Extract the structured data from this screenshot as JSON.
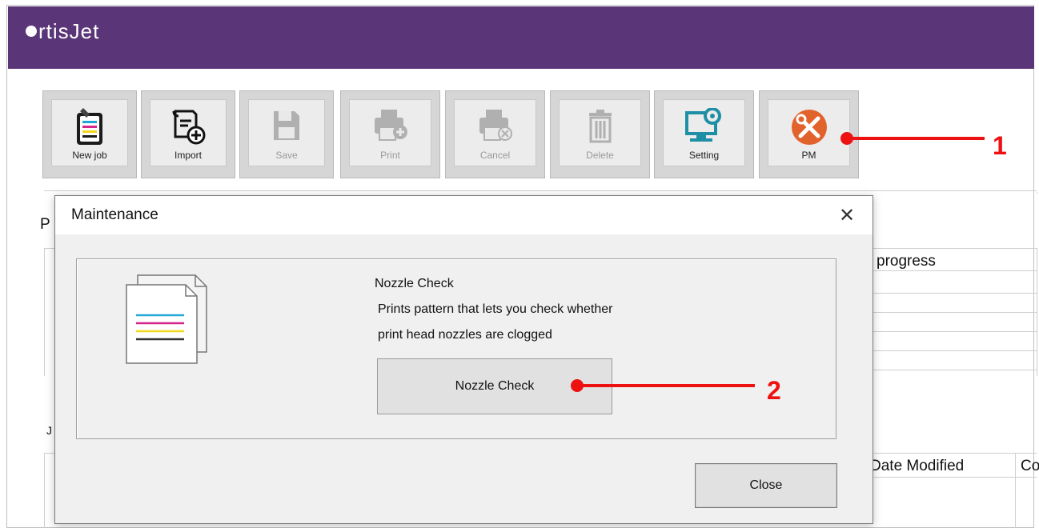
{
  "app": {
    "brand": "rtisJet"
  },
  "toolbar": {
    "buttons": [
      {
        "label": "New job",
        "icon": "new-job-icon",
        "enabled": true
      },
      {
        "label": "Import",
        "icon": "import-icon",
        "enabled": true
      },
      {
        "label": "Save",
        "icon": "save-icon",
        "enabled": false
      },
      {
        "label": "Print",
        "icon": "print-icon",
        "enabled": false
      },
      {
        "label": "Cancel",
        "icon": "cancel-print-icon",
        "enabled": false
      },
      {
        "label": "Delete",
        "icon": "trash-icon",
        "enabled": false
      },
      {
        "label": "Setting",
        "icon": "monitor-gear-icon",
        "enabled": true
      },
      {
        "label": "PM",
        "icon": "tools-icon",
        "enabled": true
      }
    ]
  },
  "background": {
    "table1_header": "progress",
    "table2_header_date": "Date Modified",
    "table2_header_partial": "Co",
    "section_letter_1": "P",
    "section_letter_2": "J"
  },
  "dialog": {
    "title": "Maintenance",
    "close_glyph": "✕",
    "nozzle_check": {
      "heading": "Nozzle Check",
      "description_line1": "Prints pattern that lets you check whether",
      "description_line2": "print head nozzles are clogged",
      "button_label": "Nozzle Check"
    },
    "close_label": "Close"
  },
  "callouts": {
    "one": "1",
    "two": "2"
  },
  "colors": {
    "titlebar": "#5a3577",
    "callout": "#ee1111",
    "pm_orange": "#e2622b",
    "setting_teal": "#1f8fa6"
  }
}
